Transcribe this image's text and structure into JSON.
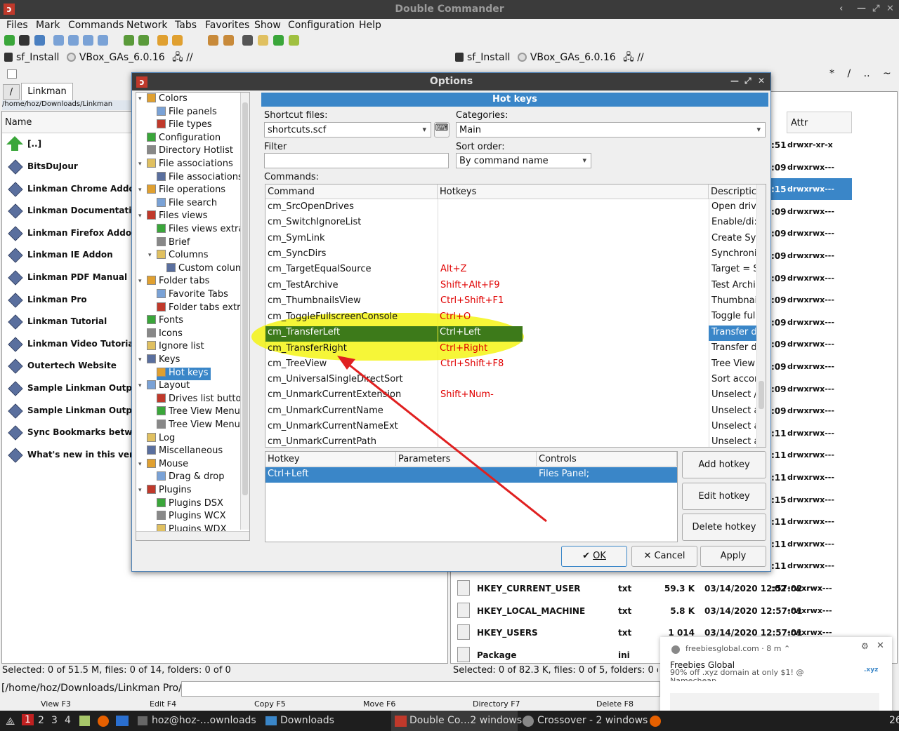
{
  "window": {
    "title": "Double Commander",
    "controls": [
      "‹",
      "—",
      "⤢",
      "✕"
    ]
  },
  "menu": [
    "Files",
    "Mark",
    "Commands",
    "Network",
    "Tabs",
    "Favorites",
    "Show",
    "Configuration",
    "Help"
  ],
  "drivebar": {
    "left": {
      "drive": "sf_Install",
      "volume": "VBox_GAs_6.0.16",
      "net": "//"
    },
    "right": {
      "drive": "sf_Install",
      "volume": "VBox_GAs_6.0.16",
      "net": "//"
    },
    "right_nav": [
      "*",
      "/",
      "..",
      "~",
      ">"
    ]
  },
  "left_panel": {
    "tab_root": "/",
    "tab": "Linkman",
    "path": "/home/hoz/Downloads/Linkman",
    "col_name": "Name",
    "parent": "[..]",
    "files": [
      "BitsDuJour",
      "Linkman Chrome Addon",
      "Linkman Documentation",
      "Linkman Firefox Addon",
      "Linkman IE Addon",
      "Linkman PDF Manual",
      "Linkman Pro",
      "Linkman Tutorial",
      "Linkman Video Tutorial",
      "Outertech Website",
      "Sample Linkman Output 1",
      "Sample Linkman Output 2",
      "Sync Bookmarks between",
      "What's new in this version"
    ],
    "status": "Selected: 0 of 51.5 M, files: 0 of 14, folders: 0 of 0"
  },
  "right_panel": {
    "col_attr": "Attr",
    "partial_rows": [
      {
        "time": ":51",
        "attr": "drwxr-xr-x"
      },
      {
        "time": ":09",
        "attr": "drwxrwx---"
      },
      {
        "time": ":15",
        "attr": "drwxrwx---"
      },
      {
        "time": ":09",
        "attr": "drwxrwx---"
      },
      {
        "time": ":09",
        "attr": "drwxrwx---"
      },
      {
        "time": ":09",
        "attr": "drwxrwx---"
      },
      {
        "time": ":09",
        "attr": "drwxrwx---"
      },
      {
        "time": ":09",
        "attr": "drwxrwx---"
      },
      {
        "time": ":09",
        "attr": "drwxrwx---"
      },
      {
        "time": ":09",
        "attr": "drwxrwx---"
      },
      {
        "time": ":09",
        "attr": "drwxrwx---"
      },
      {
        "time": ":09",
        "attr": "drwxrwx---"
      },
      {
        "time": ":09",
        "attr": "drwxrwx---"
      },
      {
        "time": ":11",
        "attr": "drwxrwx---"
      },
      {
        "time": ":11",
        "attr": "drwxrwx---"
      },
      {
        "time": ":11",
        "attr": "drwxrwx---"
      },
      {
        "time": ":15",
        "attr": "drwxrwx---"
      },
      {
        "time": ":11",
        "attr": "drwxrwx---"
      },
      {
        "time": ":11",
        "attr": "drwxrwx---"
      },
      {
        "time": ":11",
        "attr": "drwxrwx---"
      },
      {
        "time": ":02",
        "attr": "-rwxrwx---"
      }
    ],
    "files": [
      {
        "name": "HKEY_CURRENT_USER",
        "ext": "txt",
        "size": "59.3 K",
        "date": "03/14/2020 12:57:02",
        "attr": "-rwxrwx---"
      },
      {
        "name": "HKEY_LOCAL_MACHINE",
        "ext": "txt",
        "size": "5.8 K",
        "date": "03/14/2020 12:57:01",
        "attr": "-rwxrwx---"
      },
      {
        "name": "HKEY_USERS",
        "ext": "txt",
        "size": "1 014",
        "date": "03/14/2020 12:57:01",
        "attr": "-rwxrwx---"
      },
      {
        "name": "Package",
        "ext": "ini",
        "size": "",
        "date": "",
        "attr": ""
      }
    ],
    "status": "Selected: 0 of 82.3 K, files: 0 of 5, folders: 0 of 1"
  },
  "cmdline": "[/home/hoz/Downloads/Linkman Pro/]$:",
  "fnkeys": [
    "View F3",
    "Edit F4",
    "Copy F5",
    "Move F6",
    "Directory F7",
    "Delete F8"
  ],
  "options": {
    "title": "Options",
    "page_title": "Hot keys",
    "controls": [
      "—",
      "⤢",
      "✕"
    ],
    "tree": [
      {
        "label": "Colors",
        "indent": 0,
        "exp": "▾"
      },
      {
        "label": "File panels",
        "indent": 1
      },
      {
        "label": "File types",
        "indent": 1
      },
      {
        "label": "Configuration",
        "indent": 0
      },
      {
        "label": "Directory Hotlist",
        "indent": 0
      },
      {
        "label": "File associations",
        "indent": 0,
        "exp": "▾"
      },
      {
        "label": "File associations ex",
        "indent": 1
      },
      {
        "label": "File operations",
        "indent": 0,
        "exp": "▾"
      },
      {
        "label": "File search",
        "indent": 1
      },
      {
        "label": "Files views",
        "indent": 0,
        "exp": "▾"
      },
      {
        "label": "Files views extra",
        "indent": 1
      },
      {
        "label": "Brief",
        "indent": 1
      },
      {
        "label": "Columns",
        "indent": 1,
        "exp": "▾"
      },
      {
        "label": "Custom columns",
        "indent": 2
      },
      {
        "label": "Folder tabs",
        "indent": 0,
        "exp": "▾"
      },
      {
        "label": "Favorite Tabs",
        "indent": 1
      },
      {
        "label": "Folder tabs extra",
        "indent": 1
      },
      {
        "label": "Fonts",
        "indent": 0
      },
      {
        "label": "Icons",
        "indent": 0
      },
      {
        "label": "Ignore list",
        "indent": 0
      },
      {
        "label": "Keys",
        "indent": 0,
        "exp": "▾"
      },
      {
        "label": "Hot keys",
        "indent": 1,
        "selected": true
      },
      {
        "label": "Layout",
        "indent": 0,
        "exp": "▾"
      },
      {
        "label": "Drives list button",
        "indent": 1
      },
      {
        "label": "Tree View Menu",
        "indent": 1
      },
      {
        "label": "Tree View Menu Co",
        "indent": 1
      },
      {
        "label": "Log",
        "indent": 0
      },
      {
        "label": "Miscellaneous",
        "indent": 0
      },
      {
        "label": "Mouse",
        "indent": 0,
        "exp": "▾"
      },
      {
        "label": "Drag & drop",
        "indent": 1
      },
      {
        "label": "Plugins",
        "indent": 0,
        "exp": "▾"
      },
      {
        "label": "Plugins DSX",
        "indent": 1
      },
      {
        "label": "Plugins WCX",
        "indent": 1
      },
      {
        "label": "Plugins WDX",
        "indent": 1
      }
    ],
    "shortcut_files_label": "Shortcut files:",
    "shortcut_file": "shortcuts.scf",
    "categories_label": "Categories:",
    "category": "Main",
    "filter_label": "Filter",
    "filter_value": "",
    "sort_label": "Sort order:",
    "sort_value": "By command name",
    "commands_label": "Commands:",
    "cols": [
      "Command",
      "Hotkeys",
      "Descriptic"
    ],
    "commands": [
      {
        "cmd": "cm_SrcOpenDrives",
        "key": "",
        "desc": "Open driv"
      },
      {
        "cmd": "cm_SwitchIgnoreList",
        "key": "",
        "desc": "Enable/di:"
      },
      {
        "cmd": "cm_SymLink",
        "key": "",
        "desc": "Create Syı"
      },
      {
        "cmd": "cm_SyncDirs",
        "key": "",
        "desc": "Synchroni"
      },
      {
        "cmd": "cm_TargetEqualSource",
        "key": "Alt+Z",
        "desc": "Target = S"
      },
      {
        "cmd": "cm_TestArchive",
        "key": "Shift+Alt+F9",
        "desc": "Test Archi"
      },
      {
        "cmd": "cm_ThumbnailsView",
        "key": "Ctrl+Shift+F1",
        "desc": "Thumbnai"
      },
      {
        "cmd": "cm_ToggleFullscreenConsole",
        "key": "Ctrl+O",
        "desc": "Toggle ful"
      },
      {
        "cmd": "cm_TransferLeft",
        "key": "Ctrl+Left",
        "desc": "Transfer d",
        "selected": true
      },
      {
        "cmd": "cm_TransferRight",
        "key": "Ctrl+Right",
        "desc": "Transfer d"
      },
      {
        "cmd": "cm_TreeView",
        "key": "Ctrl+Shift+F8",
        "desc": "Tree View"
      },
      {
        "cmd": "cm_UniversalSingleDirectSort",
        "key": "",
        "desc": "Sort accor"
      },
      {
        "cmd": "cm_UnmarkCurrentExtension",
        "key": "Shift+Num-",
        "desc": "Unselect /"
      },
      {
        "cmd": "cm_UnmarkCurrentName",
        "key": "",
        "desc": "Unselect a"
      },
      {
        "cmd": "cm_UnmarkCurrentNameExt",
        "key": "",
        "desc": "Unselect a"
      },
      {
        "cmd": "cm_UnmarkCurrentPath",
        "key": "",
        "desc": "Unselect a"
      }
    ],
    "hk_cols": [
      "Hotkey",
      "Parameters",
      "Controls"
    ],
    "hk_row": {
      "hotkey": "Ctrl+Left",
      "params": "",
      "controls": "Files Panel;"
    },
    "btn_add": "Add hotkey",
    "btn_edit": "Edit hotkey",
    "btn_delete": "Delete hotkey",
    "btn_ok": "OK",
    "btn_cancel": "Cancel",
    "btn_apply": "Apply"
  },
  "notification": {
    "source": "freebiesglobal.com · 8 m ⌃",
    "title": "Freebies Global",
    "body": "90% off .xyz domain at only $1! @",
    "body2": "Namecheap",
    "badge": ".xyz"
  },
  "taskbar": {
    "workspaces": [
      "1",
      "2",
      "3",
      "4"
    ],
    "items": [
      "hoz@hoz-…ownloads",
      "Downloads",
      "Double Co…2 windows",
      "Crossover - 2 windows"
    ],
    "clock_frag": "26"
  },
  "colors": {
    "accent": "#3a86c8",
    "highlight": "#f4f400",
    "selectedGreen": "#3d7a1a",
    "hotkeyRed": "#e00000",
    "arrow": "#e02020"
  }
}
